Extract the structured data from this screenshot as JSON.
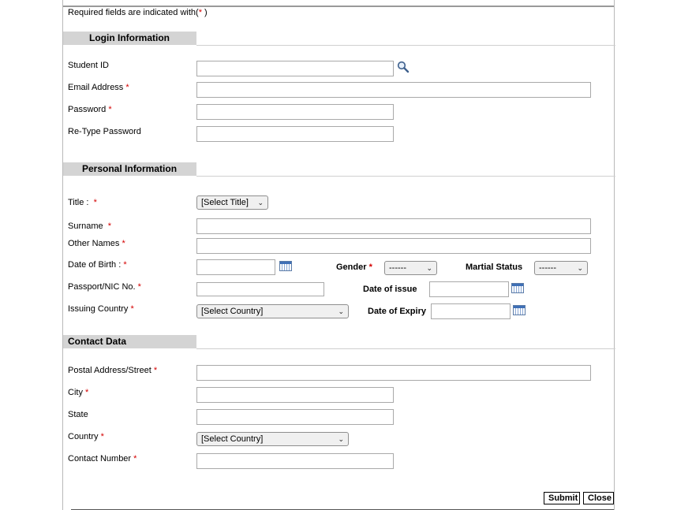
{
  "required_note": {
    "prefix": "Required fields are indicated with(",
    "star": "*",
    "suffix": " )"
  },
  "sections": {
    "login": "Login Information",
    "personal": "Personal Information",
    "contact": "Contact Data"
  },
  "login": {
    "student_id": "Student ID",
    "email": "Email Address",
    "password": "Password",
    "retype_password": "Re-Type Password"
  },
  "personal": {
    "title": "Title :",
    "title_select": "[Select Title]",
    "surname": "Surname",
    "other_names": "Other Names",
    "dob": "Date of Birth :",
    "gender": "Gender",
    "gender_select": "------",
    "marital_status": "Martial Status",
    "marital_select": "------",
    "passport": "Passport/NIC No.",
    "date_of_issue": "Date of issue",
    "issuing_country": "Issuing Country",
    "issuing_country_select": "[Select Country]",
    "date_of_expiry": "Date of Expiry"
  },
  "contact": {
    "postal_address": "Postal Address/Street",
    "city": "City",
    "state": "State",
    "country": "Country",
    "country_select": "[Select Country]",
    "contact_number": "Contact Number"
  },
  "buttons": {
    "submit": "Submit",
    "close": "Close"
  },
  "required_star": "*",
  "colors": {
    "required": "#d40000",
    "section_bg": "#d4d4d4"
  },
  "icons": {
    "lookup": "magnifier-icon",
    "calendar": "calendar-icon"
  }
}
